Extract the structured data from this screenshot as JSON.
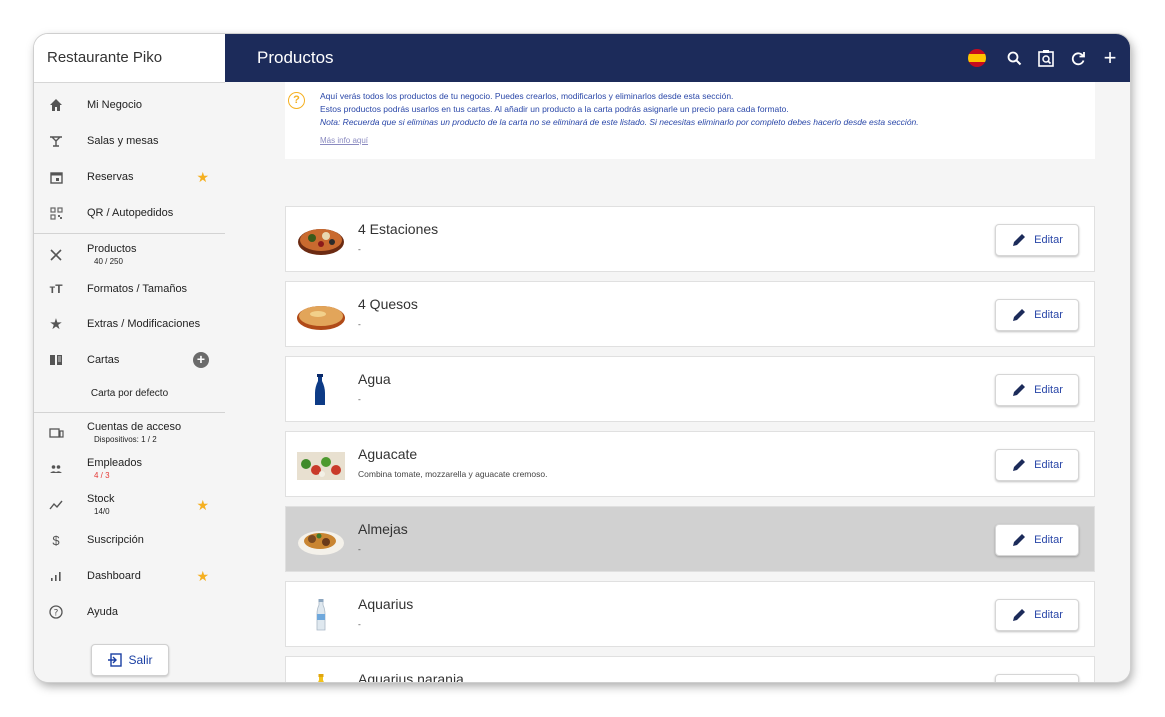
{
  "sidebar": {
    "brand": "Restaurante Piko",
    "items": [
      {
        "label": "Mi Negocio",
        "icon": "home-icon"
      },
      {
        "label": "Salas y mesas",
        "icon": "table-icon"
      },
      {
        "label": "Reservas",
        "icon": "calendar-icon",
        "star": true
      },
      {
        "label": "QR / Autopedidos",
        "icon": "qr-icon"
      },
      {
        "label": "Productos",
        "sub": "40 / 250",
        "icon": "utensils-icon"
      },
      {
        "label": "Formatos / Tamaños",
        "icon": "text-size-icon"
      },
      {
        "label": "Extras / Modificaciones",
        "icon": "star-icon"
      },
      {
        "label": "Cartas",
        "icon": "book-icon"
      },
      {
        "label": "Cuentas de acceso",
        "sub": "Dispositivos: 1 / 2",
        "icon": "devices-icon"
      },
      {
        "label": "Empleados",
        "sub": "4 / 3",
        "icon": "people-icon"
      },
      {
        "label": "Stock",
        "sub": "14/0",
        "icon": "trend-icon",
        "star": true
      },
      {
        "label": "Suscripción",
        "icon": "dollar-icon"
      },
      {
        "label": "Dashboard",
        "icon": "bar-chart-icon",
        "star": true
      },
      {
        "label": "Ayuda",
        "icon": "help-icon"
      }
    ],
    "carta_default": "Carta por defecto",
    "logout_label": "Salir"
  },
  "header": {
    "title": "Productos"
  },
  "info": {
    "line1": "Aquí verás todos los productos de tu negocio. Puedes crearlos, modificarlos y eliminarlos desde esta sección.",
    "line2": "Estos productos podrás usarlos en tus cartas. Al añadir un producto a la carta podrás asignarle un precio para cada formato.",
    "line3": "Nota: Recuerda que si eliminas un producto de la carta no se eliminará de este listado. Si necesitas eliminarlo por completo debes hacerlo desde esta sección.",
    "link": "Más info aquí"
  },
  "products": [
    {
      "name": "4 Estaciones",
      "desc": "-",
      "thumb": "pizza"
    },
    {
      "name": "4 Quesos",
      "desc": "-",
      "thumb": "pizza-cheese"
    },
    {
      "name": "Agua",
      "desc": "-",
      "thumb": "water-bottle"
    },
    {
      "name": "Aguacate",
      "desc": "Combina tomate, mozzarella y aguacate cremoso.",
      "thumb": "salad"
    },
    {
      "name": "Almejas",
      "desc": "-",
      "thumb": "clams"
    },
    {
      "name": "Aquarius",
      "desc": "-",
      "thumb": "drink-bottle"
    },
    {
      "name": "Aquarius naranja",
      "desc": "-",
      "thumb": "orange-bottle"
    }
  ],
  "edit_label": "Editar",
  "colors": {
    "header": "#1c2b5a",
    "accent": "#2a47a8",
    "star": "#f5b021",
    "selected_row": "#d1d1d1"
  }
}
